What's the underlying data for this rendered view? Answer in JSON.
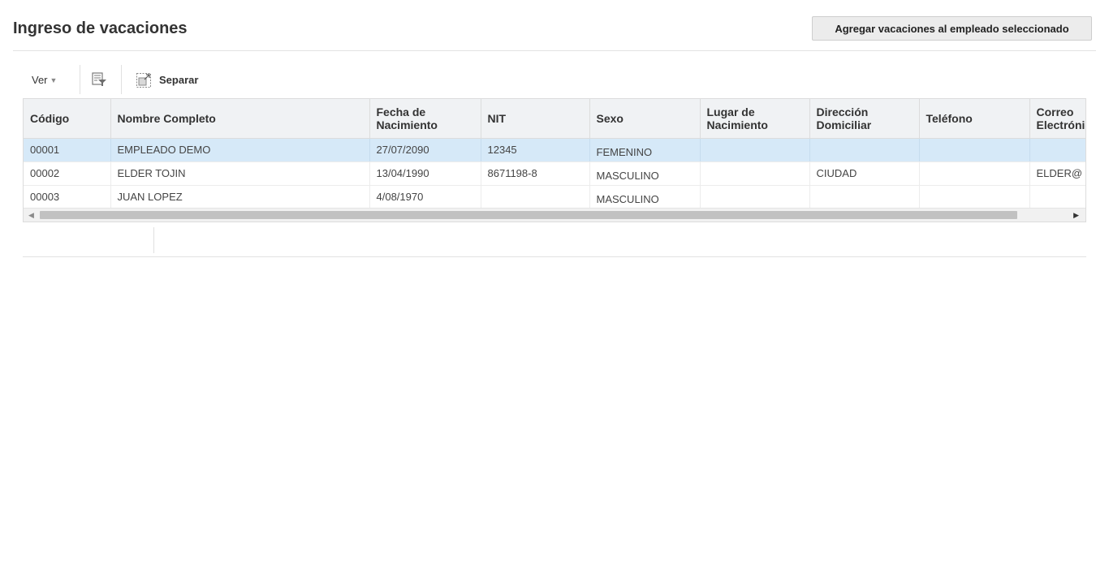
{
  "header": {
    "title": "Ingreso de vacaciones",
    "add_button_label": "Agregar vacaciones al empleado seleccionado"
  },
  "toolbar": {
    "view_label": "Ver",
    "view_icon": "triangle-down-icon",
    "filter_icon": "query-by-example-icon",
    "detach_icon": "detach-icon",
    "detach_label": "Separar"
  },
  "table": {
    "columns": [
      "Código",
      "Nombre Completo",
      "Fecha de Nacimiento",
      "NIT",
      "Sexo",
      "Lugar de Nacimiento",
      "Dirección Domiciliar",
      "Teléfono",
      "Correo Electrónico"
    ],
    "rows": [
      [
        "00001",
        "EMPLEADO DEMO",
        "27/07/2090",
        "12345",
        "FEMENINO",
        "",
        "",
        "",
        ""
      ],
      [
        "00002",
        "ELDER TOJIN",
        "13/04/1990",
        "8671198-8",
        "MASCULINO",
        "",
        "CIUDAD",
        "",
        "ELDER@"
      ],
      [
        "00003",
        "JUAN LOPEZ",
        "4/08/1970",
        "",
        "MASCULINO",
        "",
        "",
        "",
        ""
      ]
    ],
    "selected_row": 0
  },
  "colors": {
    "selected_row": "#d6e9f8",
    "header_bg": "#f0f2f4",
    "button_bg": "#ececec"
  }
}
